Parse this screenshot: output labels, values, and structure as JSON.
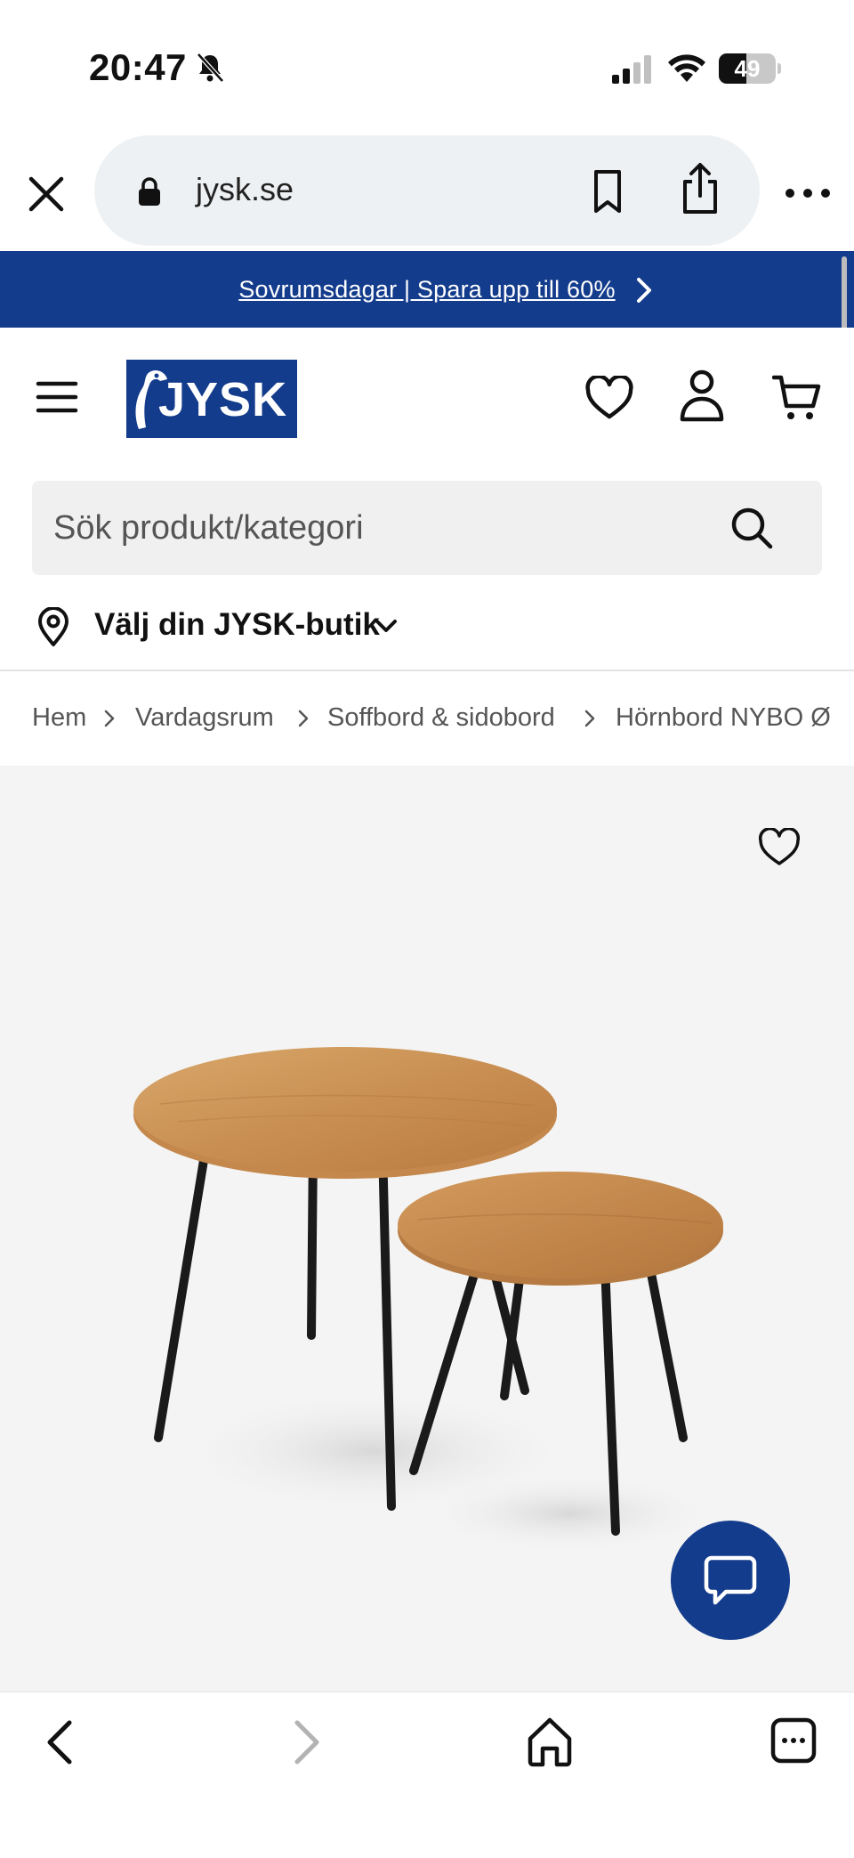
{
  "status_bar": {
    "time": "20:47",
    "battery_level": "49",
    "battery_fraction": 0.49
  },
  "browser": {
    "url": "jysk.se",
    "icons": [
      "close-icon",
      "lock-icon",
      "bookmark-icon",
      "share-icon",
      "more-icon"
    ]
  },
  "promo": {
    "text": "Sovrumsdagar | Spara upp till 60%",
    "background": "#143c8c"
  },
  "header": {
    "logo_text": "JYSK",
    "icons": [
      "menu-icon",
      "heart-icon",
      "user-icon",
      "cart-icon"
    ],
    "brand_color": "#143c8c"
  },
  "search": {
    "placeholder": "Sök produkt/kategori"
  },
  "store": {
    "label": "Välj din JYSK-butik"
  },
  "breadcrumb": {
    "items": [
      "Hem",
      "Vardagsrum",
      "Soffbord & sidobord",
      "Hörnbord NYBO Ø"
    ]
  },
  "bottom_toolbar": {
    "icons": [
      "back-icon",
      "forward-icon",
      "home-icon",
      "tabs-icon"
    ]
  }
}
